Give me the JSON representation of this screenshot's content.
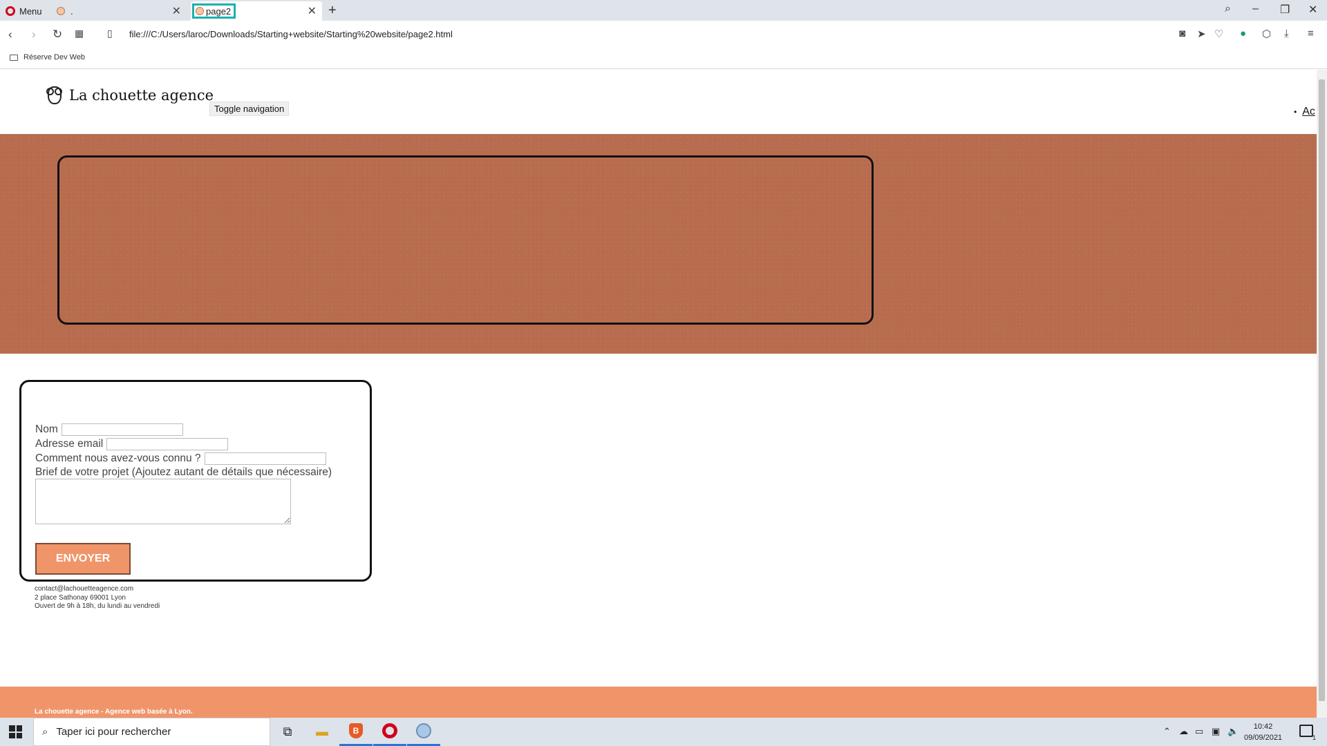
{
  "browser": {
    "menu_label": "Menu",
    "tabs": [
      {
        "title": "."
      },
      {
        "title": "page2"
      }
    ],
    "url": "file:///C:/Users/laroc/Downloads/Starting+website/Starting%20website/page2.html",
    "bookmarks": [
      {
        "label": "Réserve Dev Web"
      }
    ]
  },
  "page": {
    "logo_text": "La chouette agence",
    "toggle_nav_label": "Toggle navigation",
    "nav_items": [
      {
        "label": "Ac"
      }
    ],
    "form": {
      "name_label": "Nom",
      "name_value": "",
      "email_label": "Adresse email",
      "email_value": "",
      "source_label": "Comment nous avez-vous connu ?",
      "source_value": "",
      "brief_label": "Brief de votre projet (Ajoutez autant de détails que nécessaire)",
      "brief_value": "",
      "submit_label": "ENVOYER"
    },
    "contact": {
      "email": "contact@lachouetteagence.com",
      "address": "2 place Sathonay 69001 Lyon",
      "hours": "Ouvert de 9h à 18h, du lundi au vendredi"
    },
    "footer_text": "La chouette agence - Agence web basée à Lyon."
  },
  "taskbar": {
    "search_placeholder": "Taper ici pour rechercher",
    "time": "10:42",
    "date": "09/09/2021",
    "notification_count": "1"
  },
  "colors": {
    "hero_bg": "#b96d4f",
    "accent": "#f0956a",
    "tab_highlight": "#1ab0b0"
  }
}
